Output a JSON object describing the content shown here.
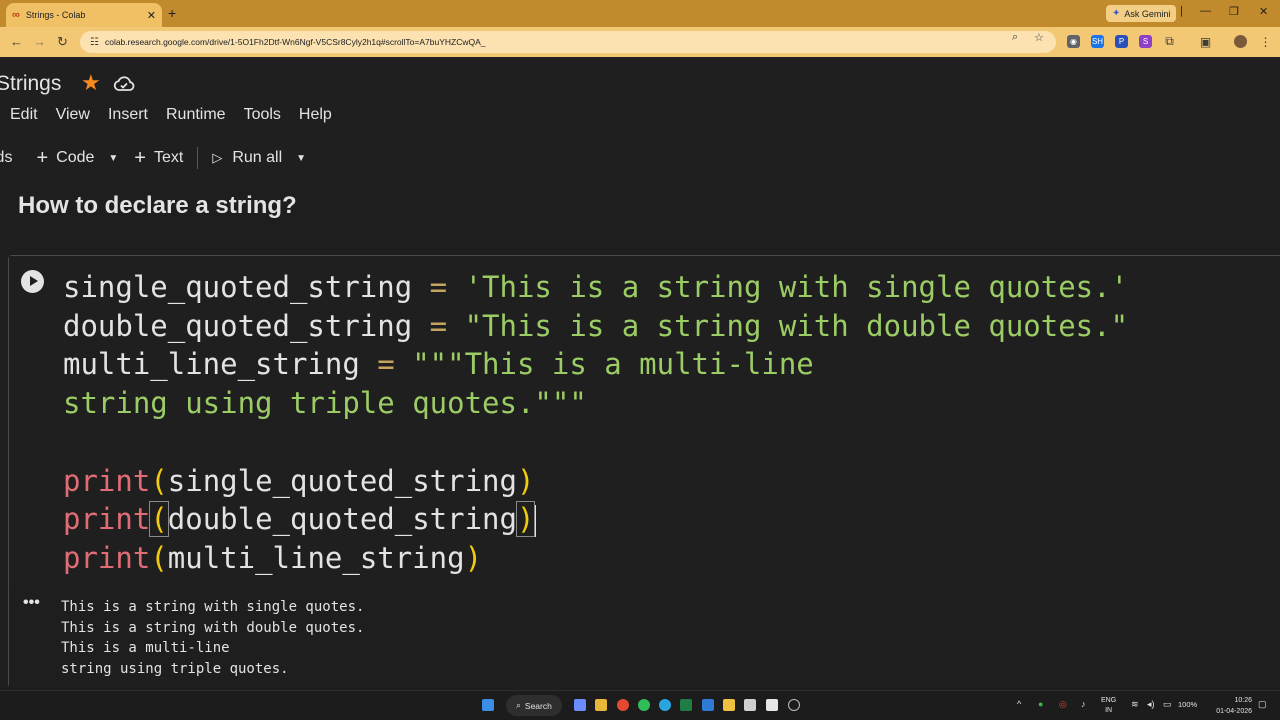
{
  "browser": {
    "tab_title": "Strings - Colab",
    "tab_favicon": "∞",
    "new_tab": "+",
    "ask_gemini": "Ask Gemini",
    "url": "colab.research.google.com/drive/1-5O1Fh2Dtf-Wn6Ngf-V5CSr8Cyly2h1q#scrollTo=A7buYHZCwQA_",
    "extensions": [
      "SH",
      "P",
      "S"
    ]
  },
  "notebook": {
    "title": "Strings",
    "menu": [
      "Edit",
      "View",
      "Insert",
      "Runtime",
      "Tools",
      "Help"
    ],
    "toolbar": {
      "fragment": "ids",
      "code": "Code",
      "text": "Text",
      "run_all": "Run all"
    },
    "heading": "How to declare a string?",
    "code": {
      "l1_var": "single_quoted_string",
      "l1_op": " = ",
      "l1_str": "'This is a string with single quotes.'",
      "l2_var": "double_quoted_string",
      "l2_op": " = ",
      "l2_str": "\"This is a string with double quotes.\"",
      "l3_var": "multi_line_string",
      "l3_op": " = ",
      "l3_str": "\"\"\"This is a multi-line",
      "l4_str": "string using triple quotes.\"\"\"",
      "print_fn": "print",
      "l6_arg": "single_quoted_string",
      "l7_arg": "double_quoted_string",
      "l8_arg": "multi_line_string",
      "open_paren": "(",
      "close_paren": ")"
    },
    "output": {
      "dots": "•••",
      "text": "This is a string with single quotes.\nThis is a string with double quotes.\nThis is a multi-line\nstring using triple quotes."
    }
  },
  "taskbar": {
    "search": "Search",
    "lang_top": "ENG",
    "lang_bottom": "IN",
    "battery": "100%",
    "time": "10:26",
    "date": "01-04-2026"
  },
  "colors": {
    "accent_star": "#f58b1f",
    "tab_strip": "#c18a2d",
    "string_green": "#9ccc65",
    "keyword_red": "#e06c75",
    "paren_yellow": "#f2cc0c"
  }
}
